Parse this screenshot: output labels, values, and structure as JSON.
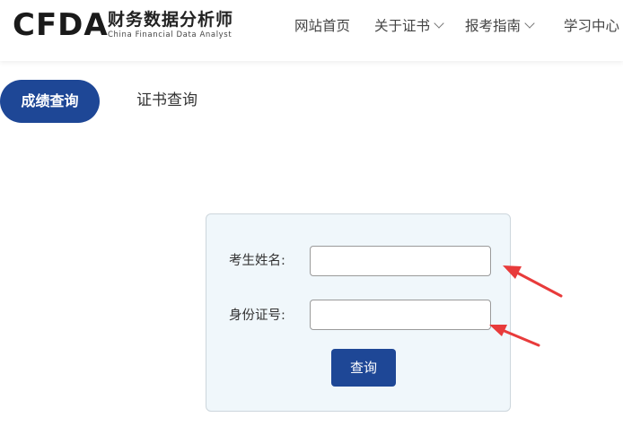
{
  "logo": {
    "mark": "CFDA",
    "name_cn": "财务数据分析师",
    "name_en": "China Financial Data Analyst"
  },
  "nav": {
    "items": [
      {
        "label": "网站首页"
      },
      {
        "label": "关于证书"
      },
      {
        "label": "报考指南"
      },
      {
        "label": "学习中心"
      }
    ]
  },
  "tabs": [
    {
      "label": "成绩查询",
      "active": true
    },
    {
      "label": "证书查询",
      "active": false
    }
  ],
  "form": {
    "name_label": "考生姓名:",
    "name_value": "",
    "id_label": "身份证号:",
    "id_value": "",
    "submit_label": "查询"
  },
  "colors": {
    "accent": "#1e4796",
    "panel_bg": "#f0f7fb",
    "annotation_arrow": "#e83b3b"
  }
}
